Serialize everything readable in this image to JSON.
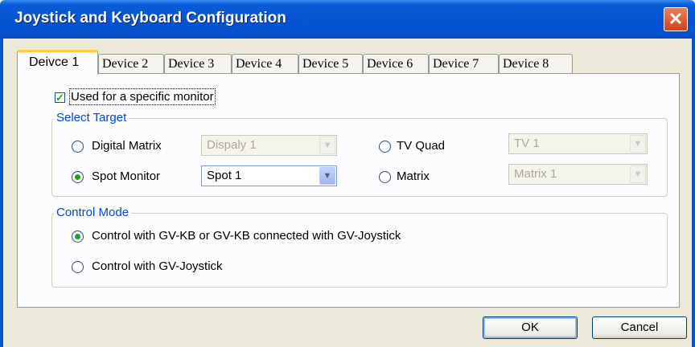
{
  "window": {
    "title": "Joystick and Keyboard Configuration",
    "close_glyph": "✕"
  },
  "tabs": [
    "Deivce 1",
    "Device 2",
    "Device 3",
    "Device 4",
    "Device 5",
    "Device 6",
    "Device 7",
    "Device 8"
  ],
  "active_tab_index": 0,
  "specific_monitor": {
    "label": "Used for a specific monitor",
    "checked": true
  },
  "select_target": {
    "legend": "Select Target",
    "digital_matrix": {
      "label": "Digital Matrix",
      "selected": false,
      "combo_value": "Dispaly 1",
      "enabled": false
    },
    "spot_monitor": {
      "label": "Spot Monitor",
      "selected": true,
      "combo_value": "Spot 1",
      "enabled": true
    },
    "tv_quad": {
      "label": "TV Quad",
      "selected": false,
      "combo_value": "TV 1",
      "enabled": false
    },
    "matrix": {
      "label": "Matrix",
      "selected": false,
      "combo_value": "Matrix 1",
      "enabled": false
    }
  },
  "control_mode": {
    "legend": "Control Mode",
    "options": [
      {
        "label": "Control with GV-KB or GV-KB connected with GV-Joystick",
        "selected": true
      },
      {
        "label": "Control with GV-Joystick",
        "selected": false
      }
    ]
  },
  "buttons": {
    "ok": "OK",
    "cancel": "Cancel"
  }
}
